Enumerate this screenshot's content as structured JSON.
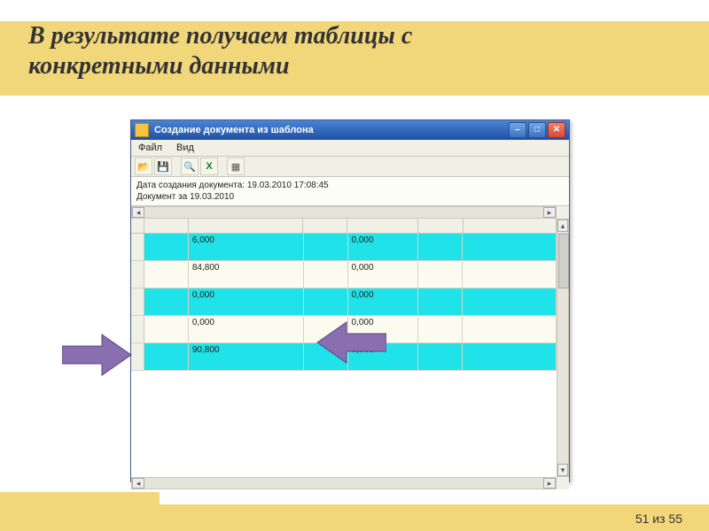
{
  "slide": {
    "title": "В результате получаем таблицы с конкретными данными",
    "page_label": "51 из 55"
  },
  "window": {
    "title": "Создание документа из шаблона",
    "menu": {
      "file": "Файл",
      "view": "Вид"
    },
    "toolbar": {
      "excel_label": "X"
    },
    "info": {
      "line1": "Дата создания документа: 19.03.2010 17:08:45",
      "line2": "Документ за 19.03.2010"
    },
    "rows": [
      {
        "style": "cyan",
        "c1": "6,000",
        "c2": "0,000"
      },
      {
        "style": "beige",
        "c1": "84,800",
        "c2": "0,000"
      },
      {
        "style": "cyan",
        "c1": "0,000",
        "c2": "0,000"
      },
      {
        "style": "beige",
        "c1": "0,000",
        "c2": "0,000"
      },
      {
        "style": "cyan",
        "c1": "90,800",
        "c2": "0,000"
      }
    ]
  }
}
